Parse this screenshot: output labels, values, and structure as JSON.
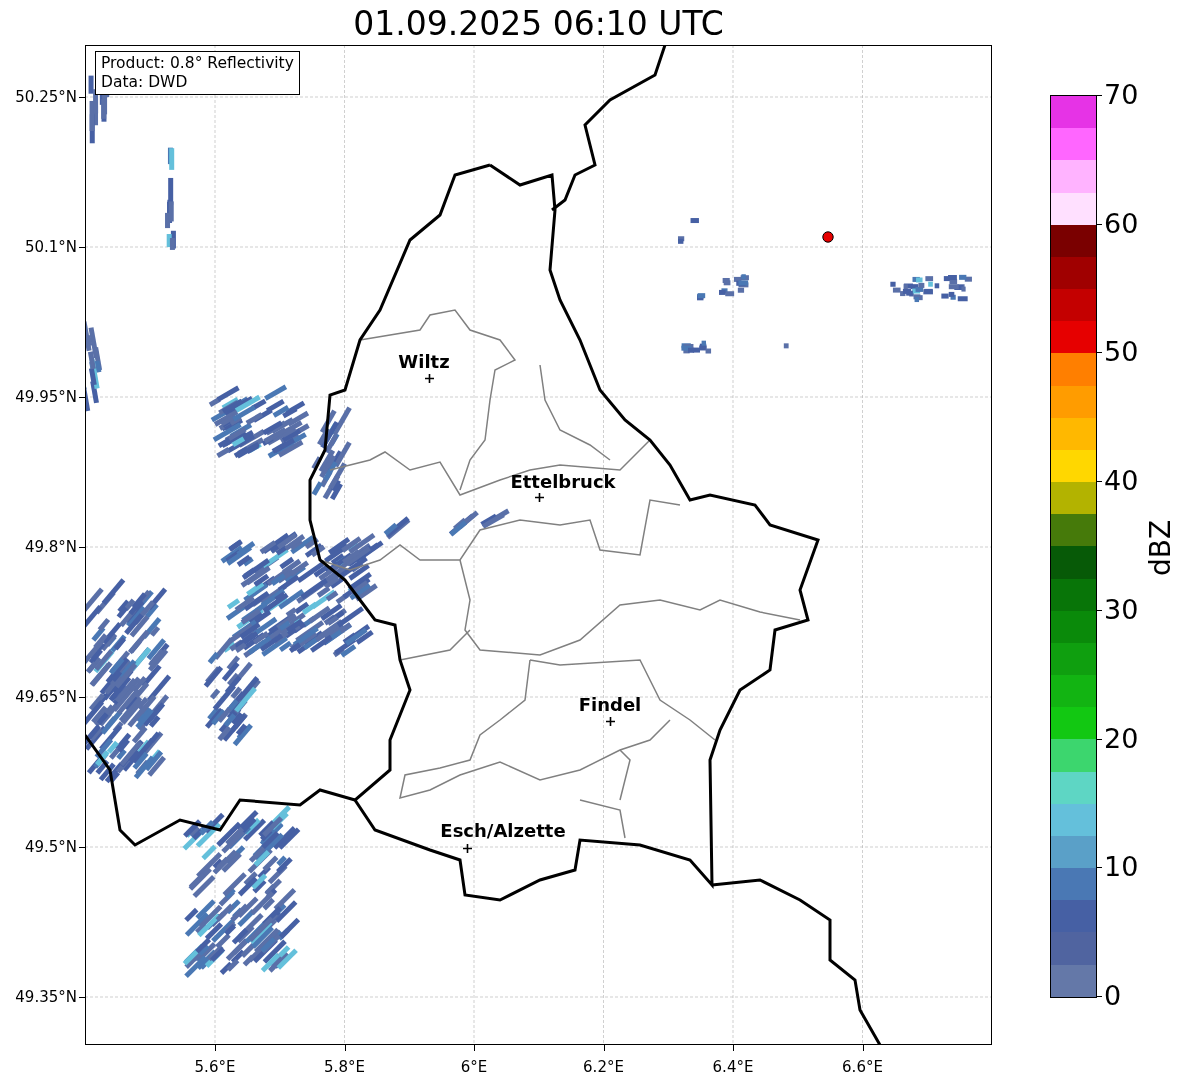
{
  "title": "01.09.2025 06:10 UTC",
  "info": [
    "Product: 0.8° Reflectivity",
    "Data: DWD"
  ],
  "yticks": [
    "50.25°N",
    "50.1°N",
    "49.95°N",
    "49.8°N",
    "49.65°N",
    "49.5°N",
    "49.35°N"
  ],
  "xticks": [
    "5.6°E",
    "5.8°E",
    "6°E",
    "6.2°E",
    "6.4°E",
    "6.6°E"
  ],
  "cities": [
    {
      "name": "Wiltz"
    },
    {
      "name": "Ettelbruck"
    },
    {
      "name": "Findel"
    },
    {
      "name": "Esch/Alzette"
    }
  ],
  "colorbar": {
    "label": "dBZ",
    "ticks": [
      "70",
      "60",
      "50",
      "40",
      "30",
      "20",
      "10",
      "0"
    ],
    "bands": [
      {
        "color": "#e633e6"
      },
      {
        "color": "#ff66ff"
      },
      {
        "color": "#ffb3ff"
      },
      {
        "color": "#ffe0ff"
      },
      {
        "color": "#7a0000"
      },
      {
        "color": "#a00000"
      },
      {
        "color": "#c40000"
      },
      {
        "color": "#e60000"
      },
      {
        "color": "#ff7f00"
      },
      {
        "color": "#ff9c00"
      },
      {
        "color": "#ffb800"
      },
      {
        "color": "#ffd700"
      },
      {
        "color": "#b3b300"
      },
      {
        "color": "#467a0a"
      },
      {
        "color": "#075a07"
      },
      {
        "color": "#087508"
      },
      {
        "color": "#0a8a0a"
      },
      {
        "color": "#0f9f0f"
      },
      {
        "color": "#12b412"
      },
      {
        "color": "#12c812"
      },
      {
        "color": "#3cd66e"
      },
      {
        "color": "#5ed6c4"
      },
      {
        "color": "#64c0db"
      },
      {
        "color": "#5aa0c8"
      },
      {
        "color": "#4a78b4"
      },
      {
        "color": "#4660a4"
      },
      {
        "color": "#5064a0"
      },
      {
        "color": "#6478a8"
      }
    ]
  }
}
